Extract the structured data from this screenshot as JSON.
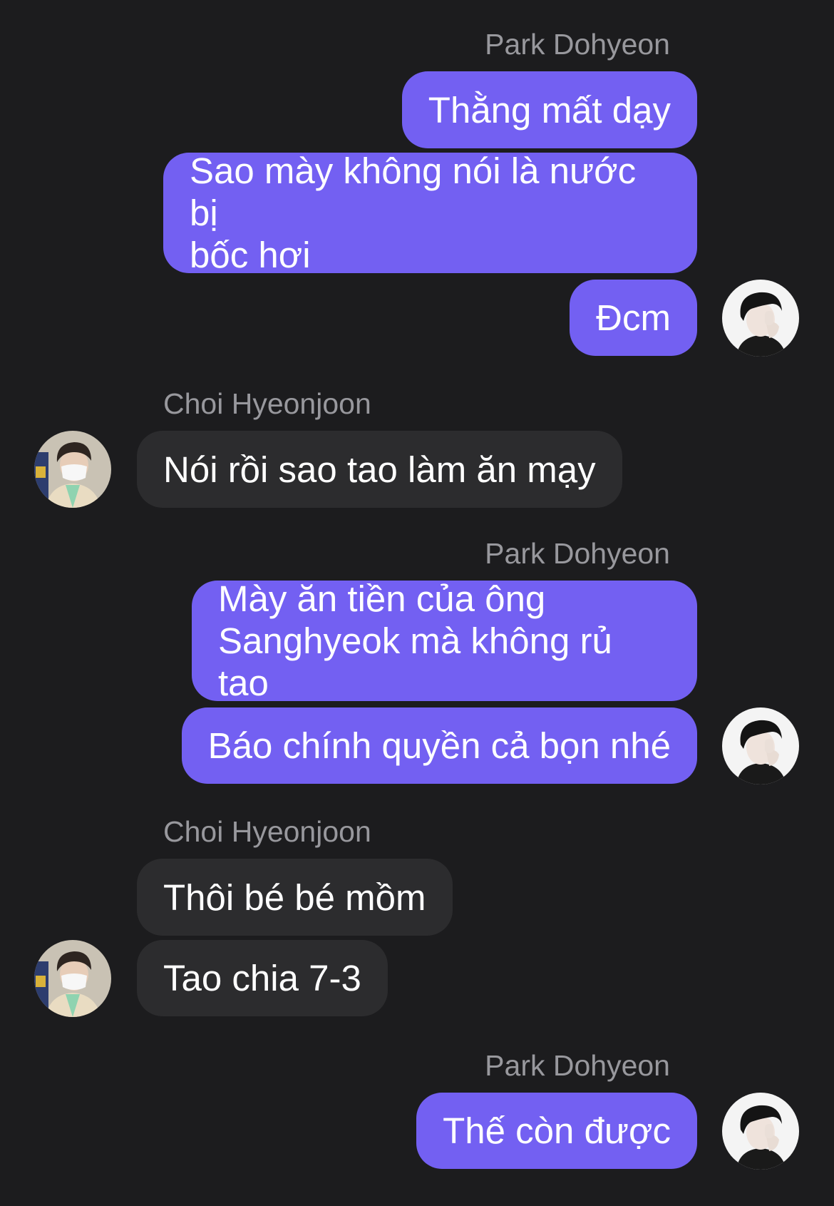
{
  "conversation": {
    "messages": [
      {
        "sender": "Park Dohyeon",
        "side": "outgoing",
        "text": "Thằng mất dạy"
      },
      {
        "sender": "Park Dohyeon",
        "side": "outgoing",
        "text": "Sao mày không nói là nước bị\nbốc hơi"
      },
      {
        "sender": "Park Dohyeon",
        "side": "outgoing",
        "text": "Đcm"
      },
      {
        "sender": "Choi Hyeonjoon",
        "side": "incoming",
        "text": "Nói rồi sao tao làm ăn mạy"
      },
      {
        "sender": "Park Dohyeon",
        "side": "outgoing",
        "text": "Mày ăn tiền của ông\nSanghyeok mà không rủ tao"
      },
      {
        "sender": "Park Dohyeon",
        "side": "outgoing",
        "text": "Báo chính quyền cả bọn nhé"
      },
      {
        "sender": "Choi Hyeonjoon",
        "side": "incoming",
        "text": "Thôi bé bé mồm"
      },
      {
        "sender": "Choi Hyeonjoon",
        "side": "incoming",
        "text": "Tao chia 7-3"
      },
      {
        "sender": "Park Dohyeon",
        "side": "outgoing",
        "text": "Thế còn được"
      }
    ],
    "groups": [
      {
        "sender_label": "Park Dohyeon"
      },
      {
        "sender_label": "Choi Hyeonjoon"
      },
      {
        "sender_label": "Park Dohyeon"
      },
      {
        "sender_label": "Choi Hyeonjoon"
      },
      {
        "sender_label": "Park Dohyeon"
      }
    ]
  },
  "colors": {
    "background": "#1c1c1e",
    "outgoing_bubble": "#7360f2",
    "incoming_bubble": "#2c2c2e",
    "sender_name": "#98989d",
    "message_text": "#ffffff"
  },
  "icons": {
    "park_avatar": "avatar-dark-hair-hand-on-face",
    "choi_avatar": "avatar-face-mask-green-jacket"
  }
}
